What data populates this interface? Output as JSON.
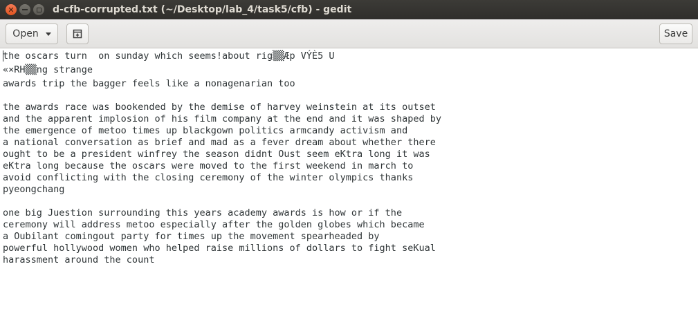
{
  "window": {
    "title": "d-cfb-corrupted.txt (~/Desktop/lab_4/task5/cfb) - gedit",
    "close_glyph": "✕",
    "minimize_glyph": "",
    "maximize_glyph": ""
  },
  "toolbar": {
    "open_label": "Open",
    "save_label": "Save",
    "new_tab_icon": "new-document-icon"
  },
  "editor": {
    "lines": [
      "the oscars turn  on sunday which seems!about rig▒▒Æp VÝÈ5 U",
      "«×RH▒▒ng strange",
      "awards trip the bagger feels like a nonagenarian too",
      "",
      "the awards race was bookended by the demise of harvey weinstein at its outset",
      "and the apparent implosion of his film company at the end and it was shaped by",
      "the emergence of metoo times up blackgown politics armcandy activism and",
      "a national conversation as brief and mad as a fever dream about whether there",
      "ought to be a president winfrey the season didnt Oust seem eKtra long it was",
      "eKtra long because the oscars were moved to the first weekend in march to",
      "avoid conflicting with the closing ceremony of the winter olympics thanks",
      "pyeongchang",
      "",
      "one big Juestion surrounding this years academy awards is how or if the",
      "ceremony will address metoo especially after the golden globes which became",
      "a Oubilant comingout party for times up the movement spearheaded by",
      "powerful hollywood women who helped raise millions of dollars to fight seKual",
      "harassment around the count"
    ]
  }
}
